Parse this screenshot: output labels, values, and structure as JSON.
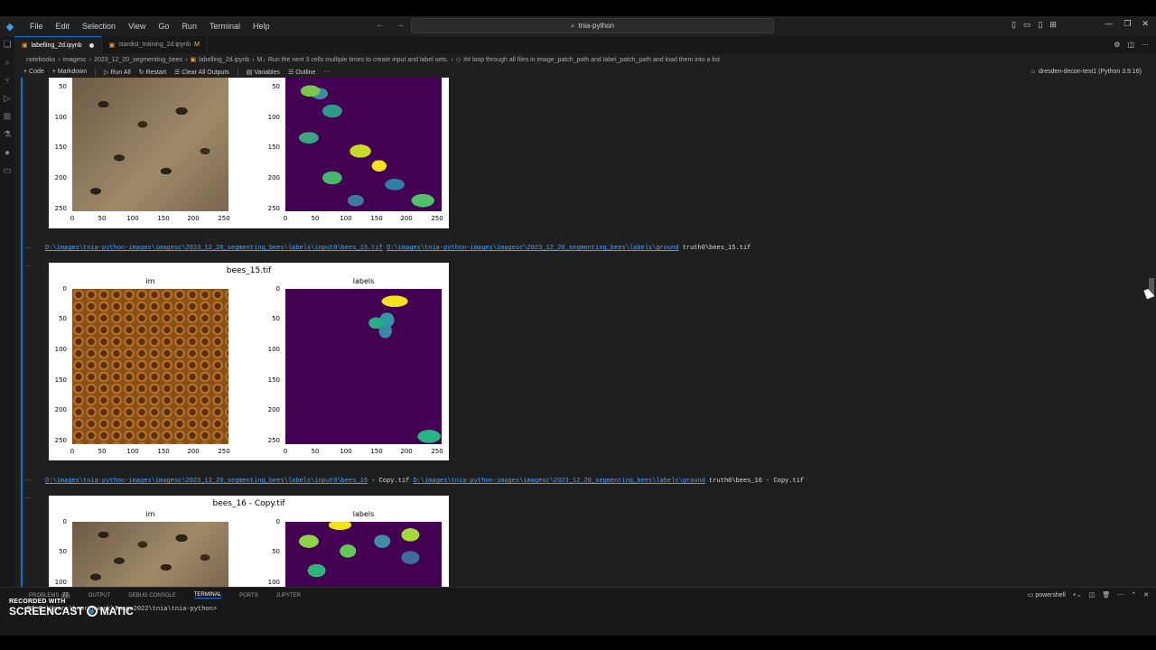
{
  "window": {
    "search": "tnia-python",
    "menu": [
      "File",
      "Edit",
      "Selection",
      "View",
      "Go",
      "Run",
      "Terminal",
      "Help"
    ]
  },
  "tabs": [
    {
      "label": "labelling_2d.ipynb",
      "active": true
    },
    {
      "label": "stardist_training_2d.ipynb",
      "suffix": "M",
      "active": false
    }
  ],
  "breadcrumb": [
    "notebooks",
    "imagesc",
    "2023_12_20_segmenting_bees",
    "labelling_2d.ipynb",
    "Run the next 3 cells multiple times to create input and label sets.",
    "## loop through all files in image_patch_path and label_patch_path and load them into a list"
  ],
  "toolbar": {
    "code": "Code",
    "markdown": "Markdown",
    "run_all": "Run All",
    "restart": "Restart",
    "clear": "Clear All Outputs",
    "variables": "Variables",
    "outline": "Outline",
    "more": "···",
    "kernel": "dresden-decon-test1 (Python 3.9.16)"
  },
  "outputs": [
    {
      "path_line": {
        "link1": "D:\\images\\tnia-python-images\\imagesc\\2023_12_20_segmenting_bees\\labels\\input0\\bees_15.tif",
        "link2": "D:\\images\\tnia-python-images\\imagesc\\2023_12_20_segmenting_bees\\labels\\ground",
        "tail": "truth0\\bees_15.tif"
      },
      "figure": {
        "title": "bees_15.tif",
        "left_title": "im",
        "right_title": "labels"
      }
    },
    {
      "path_line": {
        "link1": "D:\\images\\tnia-python-images\\imagesc\\2023_12_20_segmenting_bees\\labels\\input0\\bees_16",
        "mid": "- Copy.tif",
        "link2": "D:\\images\\tnia-python-images\\imagesc\\2023_12_20_segmenting_bees\\labels\\ground",
        "tail": "truth0\\bees_16 - Copy.tif"
      },
      "figure": {
        "title": "bees_16 - Copy.tif",
        "left_title": "im",
        "right_title": "labels"
      }
    }
  ],
  "axis": {
    "xticks": [
      "0",
      "50",
      "100",
      "150",
      "200",
      "250"
    ],
    "yticks": [
      "0",
      "50",
      "100",
      "150",
      "200",
      "250"
    ],
    "yticks_top_partial": [
      "50",
      "100",
      "150",
      "200",
      "250"
    ],
    "yticks_bottom_partial": [
      "0",
      "50",
      "100"
    ]
  },
  "ellipsis": "···",
  "panel": {
    "tabs": [
      "PROBLEMS",
      "OUTPUT",
      "DEBUG CONSOLE",
      "TERMINAL",
      "PORTS",
      "JUPYTER"
    ],
    "problems_count": "77",
    "active": "TERMINAL",
    "shell": "powershell",
    "prompt": "PS C:\\Users\\bnorthwork\\Image2022\\tnia\\tnia-python>"
  },
  "watermark": {
    "line1": "RECORDED WITH",
    "line2": "SCREENCAST",
    "line3": "MATIC"
  },
  "colors": {
    "accent": "#0078d4",
    "link": "#4aa3ff",
    "viridis_bg": "#440154"
  }
}
